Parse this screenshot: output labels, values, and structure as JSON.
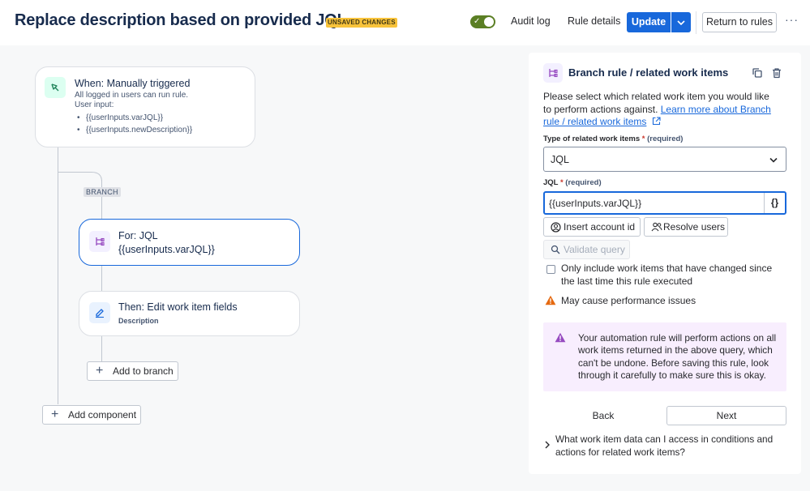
{
  "header": {
    "title": "Replace description based on provided JQL",
    "badge": "UNSAVED CHANGES",
    "toggle_check": "✓",
    "audit_log": "Audit log",
    "rule_details": "Rule details",
    "update": "Update",
    "return": "Return to rules",
    "more": "···",
    "toggle_color": "#5b7f24",
    "accent_color": "#1868db"
  },
  "canvas": {
    "trigger": {
      "title": "When: Manually triggered",
      "line1": "All logged in users can run rule.",
      "line2": "User input:",
      "inputs": [
        "{{userInputs.varJQL}}",
        "{{userInputs.newDescription}}"
      ]
    },
    "branch_label": "BRANCH",
    "branch": {
      "title": "For: JQL",
      "subtitle": "{{userInputs.varJQL}}"
    },
    "action": {
      "title": "Then: Edit work item fields",
      "subtitle": "Description"
    },
    "add_to_branch": "Add to branch",
    "add_component": "Add component"
  },
  "panel": {
    "title": "Branch rule / related work items",
    "intro_text": "Please select which related work item you would like to perform actions against. ",
    "intro_link": "Learn more about Branch rule / related work items",
    "type_label": "Type of related work items",
    "required_star": "*",
    "required_text": "(required)",
    "type_value": "JQL",
    "jql_label": "JQL",
    "jql_value": "{{userInputs.varJQL}}",
    "jql_suffix": "{}",
    "insert_account": "Insert account id",
    "resolve_users": "Resolve users",
    "validate_query": "Validate query",
    "checkbox_label": "Only include work items that have changed since the last time this rule executed",
    "warning": "May cause performance issues",
    "notice": "Your automation rule will perform actions on all work items returned in the above query, which can't be undone. Before saving this rule, look through it carefully to make sure this is okay.",
    "back": "Back",
    "next": "Next",
    "faq": "What work item data can I access in conditions and actions for related work items?"
  }
}
